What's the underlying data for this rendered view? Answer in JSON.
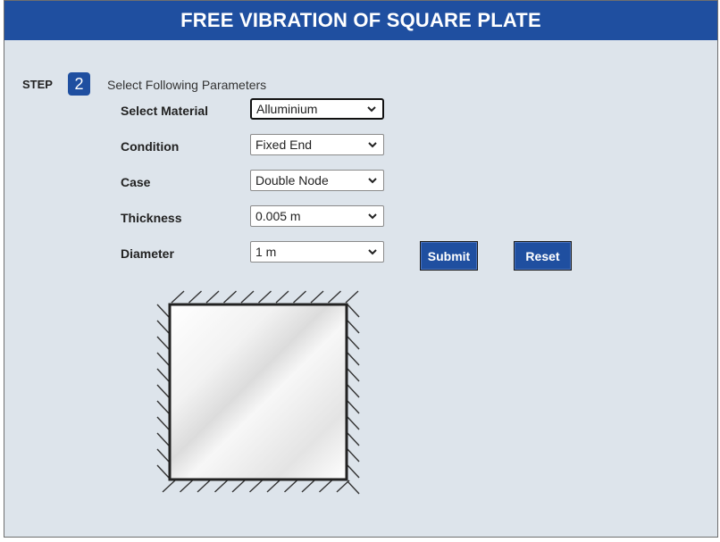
{
  "header": {
    "title": "FREE VIBRATION OF SQUARE PLATE"
  },
  "step": {
    "label": "STEP",
    "number": "2",
    "title": "Select Following Parameters"
  },
  "form": {
    "material": {
      "label": "Select Material",
      "value": "Alluminium"
    },
    "condition": {
      "label": "Condition",
      "value": "Fixed End"
    },
    "case": {
      "label": "Case",
      "value": "Double Node"
    },
    "thickness": {
      "label": "Thickness",
      "value": "0.005 m"
    },
    "diameter": {
      "label": "Diameter",
      "value": "1 m"
    }
  },
  "buttons": {
    "submit": "Submit",
    "reset": "Reset"
  },
  "icons": {
    "dropdown": "chevron-down-icon"
  },
  "colors": {
    "header_bg": "#1f4fa0",
    "page_bg": "#dde4eb",
    "button_bg": "#1f4fa0"
  }
}
